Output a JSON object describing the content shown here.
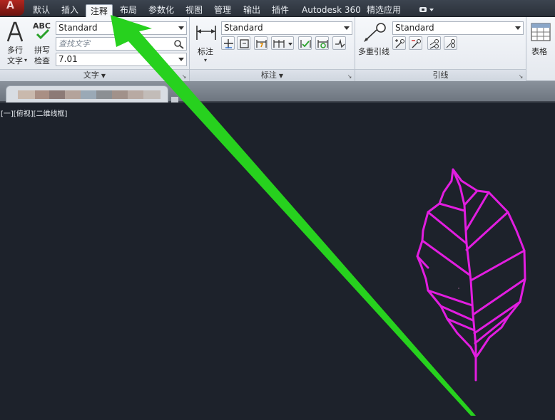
{
  "tabs": [
    {
      "label": "默认"
    },
    {
      "label": "插入"
    },
    {
      "label": "注释"
    },
    {
      "label": "布局"
    },
    {
      "label": "参数化"
    },
    {
      "label": "视图"
    },
    {
      "label": "管理"
    },
    {
      "label": "输出"
    },
    {
      "label": "插件"
    },
    {
      "label": "Autodesk 360"
    },
    {
      "label": "精选应用"
    }
  ],
  "active_tab": "注释",
  "ribbon": {
    "text_panel": {
      "multiline_text_label_1": "多行",
      "multiline_text_label_2": "文字",
      "spellcheck_icon_text": "ABC",
      "spellcheck_label_1": "拼写",
      "spellcheck_label_2": "检查",
      "style_value": "Standard",
      "find_placeholder": "查找文字",
      "height_value": "7.01",
      "title": "文字"
    },
    "dimension_panel": {
      "dimension_label": "标注",
      "style_value": "Standard",
      "title": "标注"
    },
    "leader_panel": {
      "multileader_label": "多重引线",
      "style_value": "Standard",
      "title": "引线"
    },
    "table_panel": {
      "table_label": "表格"
    }
  },
  "viewport": {
    "label": "[一][俯视][二维线框]"
  },
  "colors": {
    "canvas_bg": "#1d222b",
    "leaf_stroke": "#e21de0",
    "arrow": "#27d11e",
    "active_tab_bg": "#f4f6f9"
  },
  "icons": [
    "multiline-text-icon",
    "spellcheck-icon",
    "find-text-icon",
    "dimension-icon",
    "multileader-icon",
    "table-icon"
  ]
}
